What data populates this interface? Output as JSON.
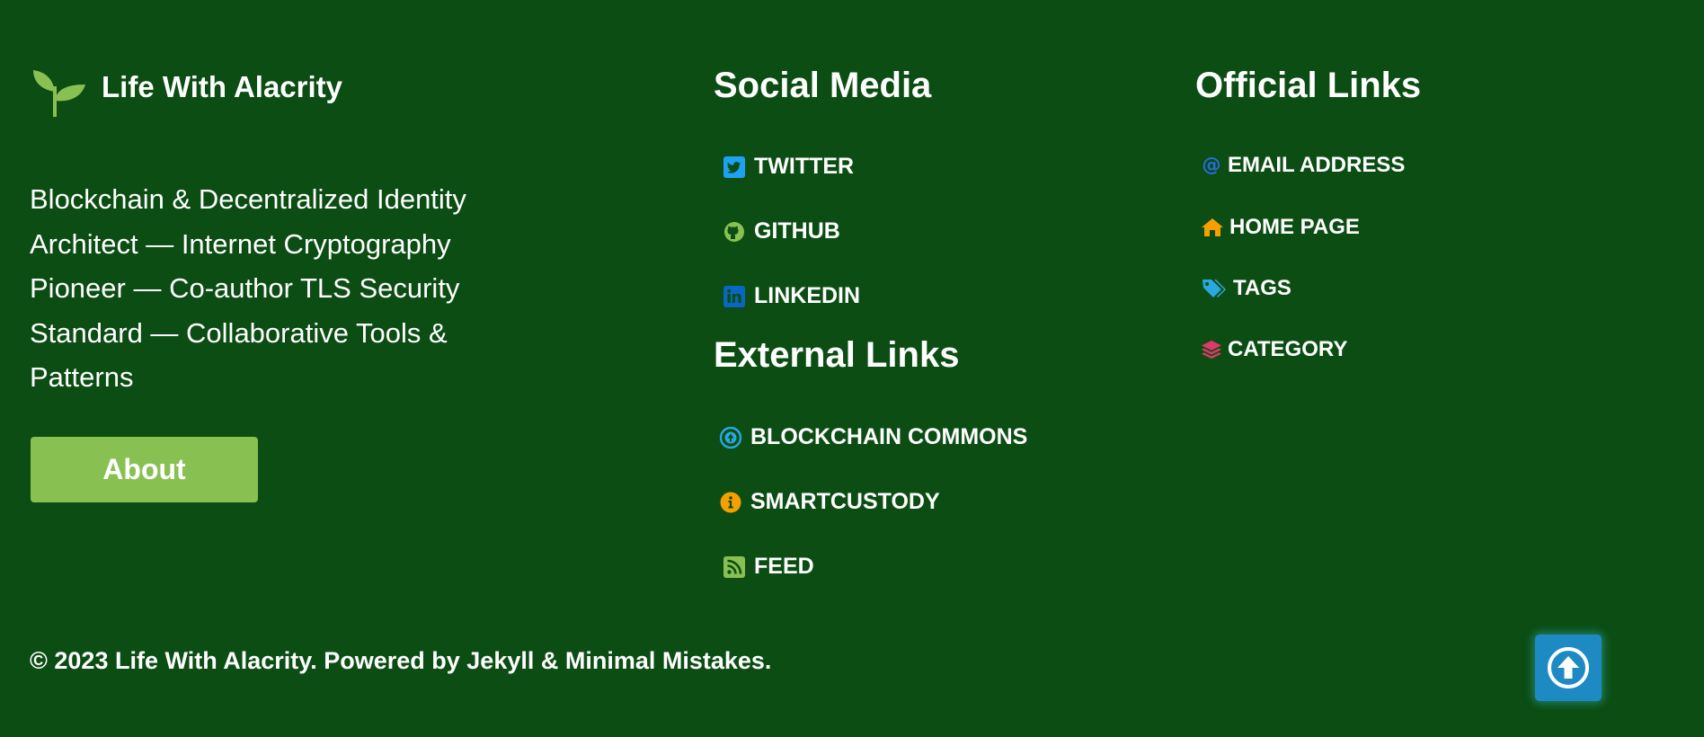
{
  "brand": {
    "name": "Life With Alacrity",
    "logo_icon": "seedling-icon",
    "logo_color": "#88c051"
  },
  "tagline": "Blockchain & Decentralized Identity Architect — Internet Cryptography Pioneer — Co-author TLS Security Standard — Collaborative Tools & Patterns",
  "about_button": {
    "label": "About",
    "color": "#88c051"
  },
  "social_media": {
    "heading": "Social Media",
    "links": [
      {
        "label": "TWITTER",
        "icon": "twitter-icon",
        "color": "#1da1f2"
      },
      {
        "label": "GITHUB",
        "icon": "github-icon",
        "color": "#88c051"
      },
      {
        "label": "LINKEDIN",
        "icon": "linkedin-icon",
        "color": "#0a66c2"
      }
    ]
  },
  "external_links": {
    "heading": "External Links",
    "links": [
      {
        "label": "BLOCKCHAIN COMMONS",
        "icon": "blockchain-commons-icon",
        "color": "#29a8e0"
      },
      {
        "label": "SMARTCUSTODY",
        "icon": "info-circle-icon",
        "color": "#f5a000"
      },
      {
        "label": "FEED",
        "icon": "rss-icon",
        "color": "#88c051"
      }
    ]
  },
  "official_links": {
    "heading": "Official Links",
    "links": [
      {
        "label": "EMAIL ADDRESS",
        "icon": "at-icon",
        "color": "#2a6be0"
      },
      {
        "label": "HOME PAGE",
        "icon": "home-icon",
        "color": "#f5a000"
      },
      {
        "label": "TAGS",
        "icon": "tags-icon",
        "color": "#29a8e0"
      },
      {
        "label": "CATEGORY",
        "icon": "layers-icon",
        "color": "#e0386a"
      }
    ]
  },
  "copyright": "© 2023 Life With Alacrity. Powered by Jekyll & Minimal Mistakes.",
  "back_to_top": {
    "icon": "arrow-circle-up-icon",
    "color": "#1e8ac4"
  },
  "colors": {
    "background": "#0b4d13",
    "text": "#ffffff"
  }
}
